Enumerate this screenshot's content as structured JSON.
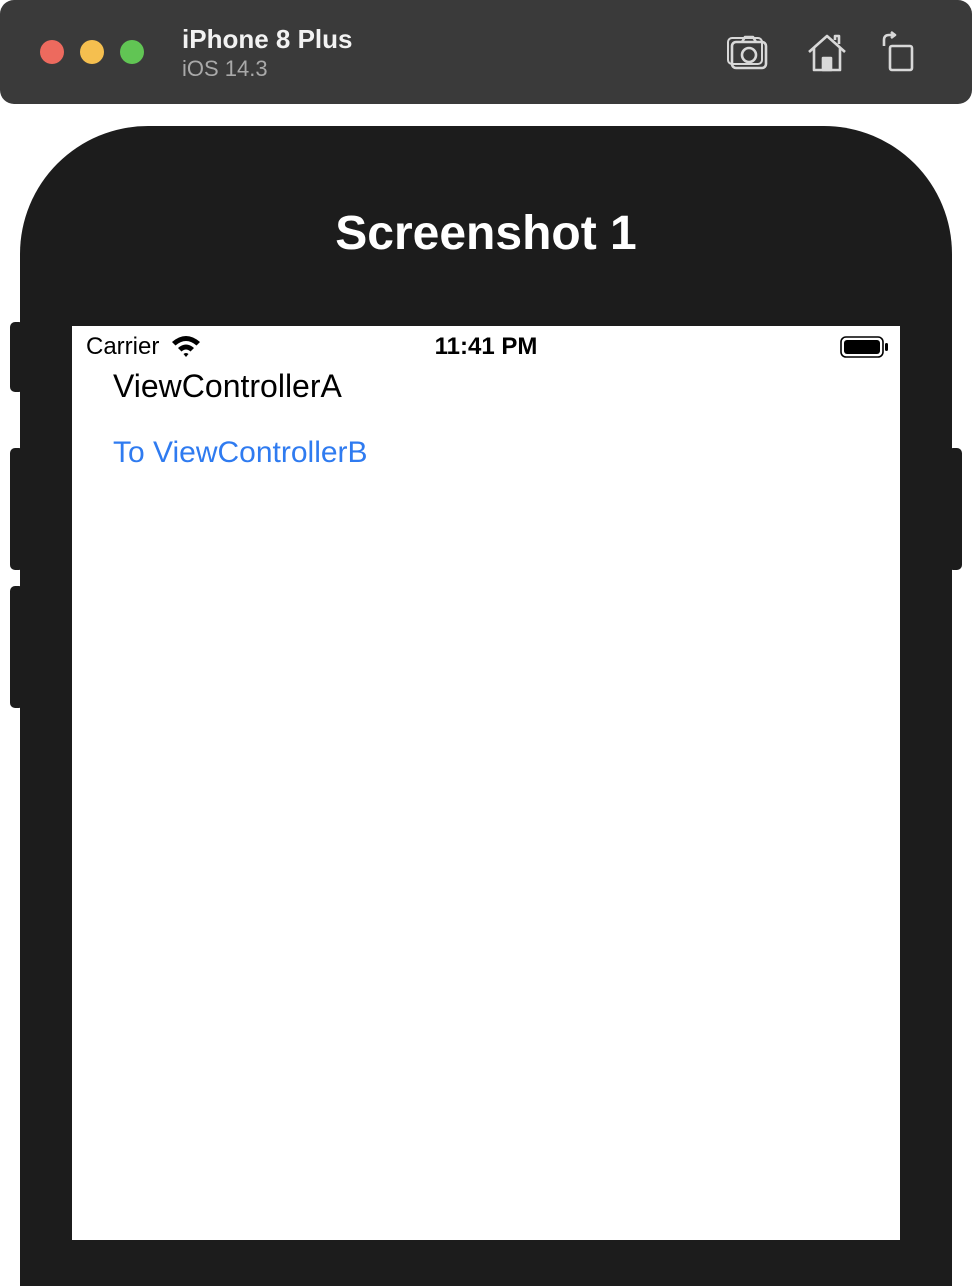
{
  "simulator": {
    "device_name": "iPhone 8 Plus",
    "os_version": "iOS 14.3",
    "toolbar_icons": [
      "screenshot-icon",
      "home-icon",
      "rotate-icon"
    ]
  },
  "overlay_title": "Screenshot 1",
  "status_bar": {
    "carrier": "Carrier",
    "time": "11:41 PM"
  },
  "screen": {
    "title": "ViewControllerA",
    "link_label": "To ViewControllerB"
  },
  "colors": {
    "link": "#2f7bf0",
    "close": "#ed6a5e",
    "minimize": "#f5bf4f",
    "maximize": "#61c554",
    "titlebar": "#3a3a3a",
    "device_frame": "#1c1c1c"
  }
}
